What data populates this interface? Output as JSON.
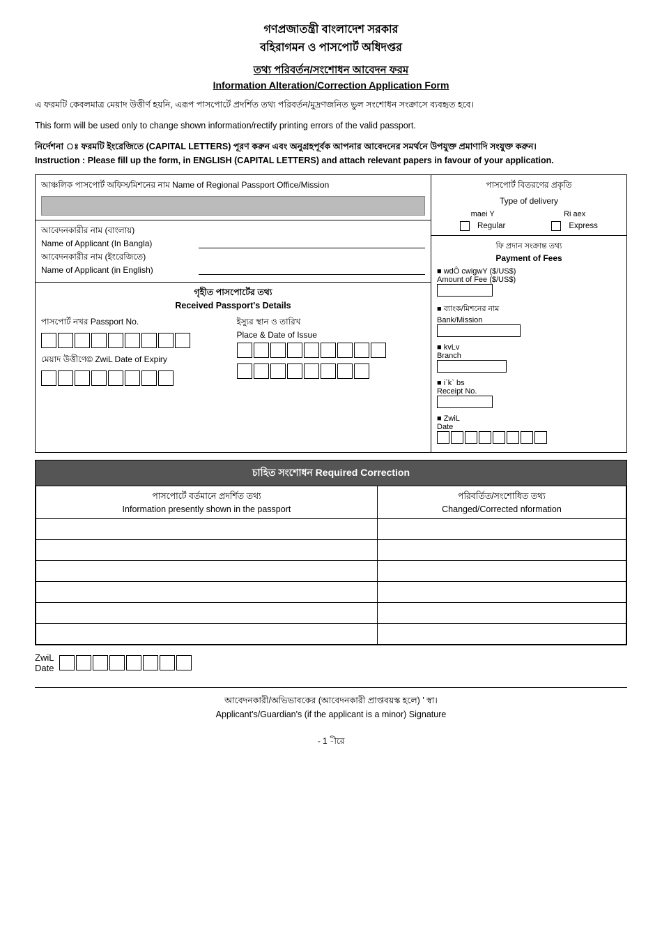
{
  "header": {
    "line1": "গণপ্রজাতন্ত্রী বাংলাদেশ সরকার",
    "line2": "বহিরাগমন ও পাসপোর্ট অধিদপ্তর",
    "form_title_bengali": "তথ্য পরিবর্তন/সংশোধন আবেদন ফরম",
    "form_title_english": "Information Alteration/Correction Application Form"
  },
  "info_text_bengali": "এ ফরমটি কেবলমাত্র মেয়াদ উত্তীর্ণ হয়নি, এরূপ পাসপোর্টে প্রদর্শিত তথ্য পরিবর্তন/মুদ্রণজনিত ভুল সংশোধন সংক্রাসে ব্যবহৃত হবে।",
  "info_text_english": "This form will be used only to change shown information/rectify printing errors of the valid passport.",
  "instruction_bengali": "নির্দেশনা ঃ ফরমটি ইংরেজিতে (CAPITAL LETTERS) পূরণ করুন এবং অনুগ্রহপূর্বক আপনার আবেদনের সমর্থনে উপযুক্ত প্রমাণাদি সংযুক্ত করুন।",
  "instruction_english": "Instruction : Please fill up the form, in ENGLISH (CAPITAL LETTERS) and attach relevant papers in favour of your application.",
  "office_section": {
    "label_bengali": "আঞ্চলিক পাসপোর্ট অফিস/মিশনের নাম Name of Regional Passport Office/Mission"
  },
  "delivery_section": {
    "title_bengali": "পাসপোর্ট বিতরণের প্রকৃতি",
    "title_english": "Type of delivery",
    "regular_bengali": "maei Y",
    "regular_english": "Regular",
    "express_bengali": "Ri aex",
    "express_english": "Express"
  },
  "applicant_section": {
    "name_bangla_bengali": "আবেদনকারীর নাম (বাংলায়)",
    "name_bangla_english": "Name of Applicant (In Bangla)",
    "name_english_bengali": "আবেদনকারীর নাম (ইংরেজিতে)",
    "name_english_english": "Name of Applicant (in English)"
  },
  "payment_section": {
    "title_bengali": "ফি প্রদান সংক্রান্ত তথ্য",
    "title_english": "Payment of Fees",
    "amount_bengali": "■ wdÔ cwigwY ($/US$)",
    "amount_english": "Amount of Fee ($/US$)",
    "bank_bengali": "■ ব্যাংক/মিশনের নাম",
    "bank_english": "Bank/Mission",
    "branch_bengali": "■ kvLv",
    "branch_english": "Branch",
    "receipt_bengali": "■ i`k` bs",
    "receipt_english": "Receipt No.",
    "date_bengali": "■ ZwiL",
    "date_english": "Date"
  },
  "passport_details": {
    "section_title_bengali": "গৃহীত পাসপোর্টের তথ্য",
    "section_title_english": "Received Passport's Details",
    "passport_no_bengali": "পাসপোর্ট নখর Passport No.",
    "issue_label_bengali": "ইস্যুর স্থান ও তারিখ",
    "issue_label_english": "Place & Date of Issue",
    "expiry_bengali": "মেয়াদ উত্তীণে© ZwiL Date of Expiry"
  },
  "correction_section": {
    "header": "চাহিত সংশোধন Required Correction",
    "col1_bengali": "পাসপোর্টে বর্তমানে প্রদর্শিত তথ্য",
    "col1_english": "Information presently shown in the passport",
    "col2_bengali": "পরিবর্তিত/সংশোধিত তথ্য",
    "col2_english": "Changed/Corrected nformation",
    "rows": 6
  },
  "date_section": {
    "label_bengali": "ZwiL",
    "label_english": "Date"
  },
  "signature_section": {
    "text_bengali": "আবেদনকারী/অভিভাবকের (আবেদনকারী প্রাপ্তবয়স্ক হলে) ' স্বা।",
    "text_english": "Applicant's/Guardian's (if the applicant is a minor) Signature"
  },
  "page_number": "- 1 -ীরে"
}
